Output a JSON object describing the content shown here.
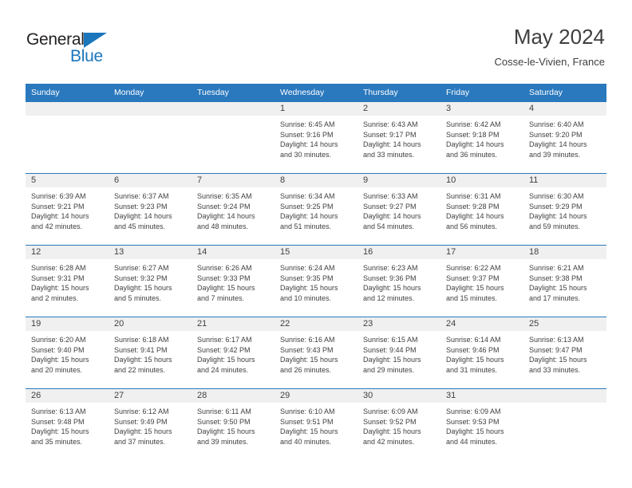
{
  "brand": {
    "name_part1": "General",
    "name_part2": "Blue",
    "triangle_icon": "blue-triangle-icon",
    "accent_color": "#1b76bc"
  },
  "header": {
    "title": "May 2024",
    "subtitle": "Cosse-le-Vivien, France"
  },
  "calendar": {
    "header_color": "#2a78bd",
    "daynum_band_color": "#f0f0f0",
    "weekdays": [
      "Sunday",
      "Monday",
      "Tuesday",
      "Wednesday",
      "Thursday",
      "Friday",
      "Saturday"
    ],
    "weeks": [
      [
        {
          "day": "",
          "lines": []
        },
        {
          "day": "",
          "lines": []
        },
        {
          "day": "",
          "lines": []
        },
        {
          "day": "1",
          "lines": [
            "Sunrise: 6:45 AM",
            "Sunset: 9:16 PM",
            "Daylight: 14 hours",
            "and 30 minutes."
          ]
        },
        {
          "day": "2",
          "lines": [
            "Sunrise: 6:43 AM",
            "Sunset: 9:17 PM",
            "Daylight: 14 hours",
            "and 33 minutes."
          ]
        },
        {
          "day": "3",
          "lines": [
            "Sunrise: 6:42 AM",
            "Sunset: 9:18 PM",
            "Daylight: 14 hours",
            "and 36 minutes."
          ]
        },
        {
          "day": "4",
          "lines": [
            "Sunrise: 6:40 AM",
            "Sunset: 9:20 PM",
            "Daylight: 14 hours",
            "and 39 minutes."
          ]
        }
      ],
      [
        {
          "day": "5",
          "lines": [
            "Sunrise: 6:39 AM",
            "Sunset: 9:21 PM",
            "Daylight: 14 hours",
            "and 42 minutes."
          ]
        },
        {
          "day": "6",
          "lines": [
            "Sunrise: 6:37 AM",
            "Sunset: 9:23 PM",
            "Daylight: 14 hours",
            "and 45 minutes."
          ]
        },
        {
          "day": "7",
          "lines": [
            "Sunrise: 6:35 AM",
            "Sunset: 9:24 PM",
            "Daylight: 14 hours",
            "and 48 minutes."
          ]
        },
        {
          "day": "8",
          "lines": [
            "Sunrise: 6:34 AM",
            "Sunset: 9:25 PM",
            "Daylight: 14 hours",
            "and 51 minutes."
          ]
        },
        {
          "day": "9",
          "lines": [
            "Sunrise: 6:33 AM",
            "Sunset: 9:27 PM",
            "Daylight: 14 hours",
            "and 54 minutes."
          ]
        },
        {
          "day": "10",
          "lines": [
            "Sunrise: 6:31 AM",
            "Sunset: 9:28 PM",
            "Daylight: 14 hours",
            "and 56 minutes."
          ]
        },
        {
          "day": "11",
          "lines": [
            "Sunrise: 6:30 AM",
            "Sunset: 9:29 PM",
            "Daylight: 14 hours",
            "and 59 minutes."
          ]
        }
      ],
      [
        {
          "day": "12",
          "lines": [
            "Sunrise: 6:28 AM",
            "Sunset: 9:31 PM",
            "Daylight: 15 hours",
            "and 2 minutes."
          ]
        },
        {
          "day": "13",
          "lines": [
            "Sunrise: 6:27 AM",
            "Sunset: 9:32 PM",
            "Daylight: 15 hours",
            "and 5 minutes."
          ]
        },
        {
          "day": "14",
          "lines": [
            "Sunrise: 6:26 AM",
            "Sunset: 9:33 PM",
            "Daylight: 15 hours",
            "and 7 minutes."
          ]
        },
        {
          "day": "15",
          "lines": [
            "Sunrise: 6:24 AM",
            "Sunset: 9:35 PM",
            "Daylight: 15 hours",
            "and 10 minutes."
          ]
        },
        {
          "day": "16",
          "lines": [
            "Sunrise: 6:23 AM",
            "Sunset: 9:36 PM",
            "Daylight: 15 hours",
            "and 12 minutes."
          ]
        },
        {
          "day": "17",
          "lines": [
            "Sunrise: 6:22 AM",
            "Sunset: 9:37 PM",
            "Daylight: 15 hours",
            "and 15 minutes."
          ]
        },
        {
          "day": "18",
          "lines": [
            "Sunrise: 6:21 AM",
            "Sunset: 9:38 PM",
            "Daylight: 15 hours",
            "and 17 minutes."
          ]
        }
      ],
      [
        {
          "day": "19",
          "lines": [
            "Sunrise: 6:20 AM",
            "Sunset: 9:40 PM",
            "Daylight: 15 hours",
            "and 20 minutes."
          ]
        },
        {
          "day": "20",
          "lines": [
            "Sunrise: 6:18 AM",
            "Sunset: 9:41 PM",
            "Daylight: 15 hours",
            "and 22 minutes."
          ]
        },
        {
          "day": "21",
          "lines": [
            "Sunrise: 6:17 AM",
            "Sunset: 9:42 PM",
            "Daylight: 15 hours",
            "and 24 minutes."
          ]
        },
        {
          "day": "22",
          "lines": [
            "Sunrise: 6:16 AM",
            "Sunset: 9:43 PM",
            "Daylight: 15 hours",
            "and 26 minutes."
          ]
        },
        {
          "day": "23",
          "lines": [
            "Sunrise: 6:15 AM",
            "Sunset: 9:44 PM",
            "Daylight: 15 hours",
            "and 29 minutes."
          ]
        },
        {
          "day": "24",
          "lines": [
            "Sunrise: 6:14 AM",
            "Sunset: 9:46 PM",
            "Daylight: 15 hours",
            "and 31 minutes."
          ]
        },
        {
          "day": "25",
          "lines": [
            "Sunrise: 6:13 AM",
            "Sunset: 9:47 PM",
            "Daylight: 15 hours",
            "and 33 minutes."
          ]
        }
      ],
      [
        {
          "day": "26",
          "lines": [
            "Sunrise: 6:13 AM",
            "Sunset: 9:48 PM",
            "Daylight: 15 hours",
            "and 35 minutes."
          ]
        },
        {
          "day": "27",
          "lines": [
            "Sunrise: 6:12 AM",
            "Sunset: 9:49 PM",
            "Daylight: 15 hours",
            "and 37 minutes."
          ]
        },
        {
          "day": "28",
          "lines": [
            "Sunrise: 6:11 AM",
            "Sunset: 9:50 PM",
            "Daylight: 15 hours",
            "and 39 minutes."
          ]
        },
        {
          "day": "29",
          "lines": [
            "Sunrise: 6:10 AM",
            "Sunset: 9:51 PM",
            "Daylight: 15 hours",
            "and 40 minutes."
          ]
        },
        {
          "day": "30",
          "lines": [
            "Sunrise: 6:09 AM",
            "Sunset: 9:52 PM",
            "Daylight: 15 hours",
            "and 42 minutes."
          ]
        },
        {
          "day": "31",
          "lines": [
            "Sunrise: 6:09 AM",
            "Sunset: 9:53 PM",
            "Daylight: 15 hours",
            "and 44 minutes."
          ]
        },
        {
          "day": "",
          "lines": []
        }
      ]
    ]
  }
}
